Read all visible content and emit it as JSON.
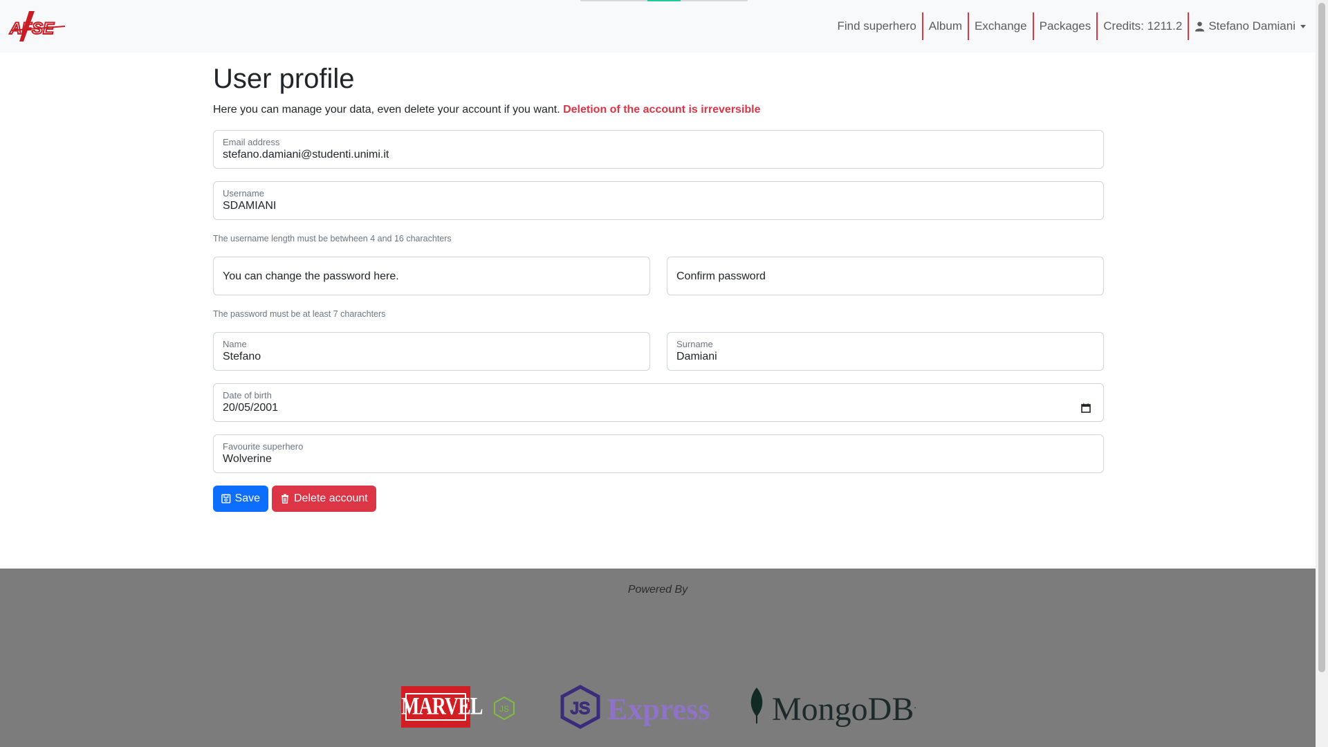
{
  "navbar": {
    "brand": "AFSE",
    "items": [
      {
        "label": "Find superhero"
      },
      {
        "label": "Album"
      },
      {
        "label": "Exchange"
      },
      {
        "label": "Packages"
      }
    ],
    "credits": "Credits: 1211.2",
    "user": "Stefano Damiani",
    "accent_color": "#dc3545"
  },
  "page": {
    "title": "User profile",
    "subtitle": "Here you can manage your data, even delete your account if you want.",
    "warning": "Deletion of the account is irreversible"
  },
  "form": {
    "email": {
      "label": "Email address",
      "value": "stefano.damiani@studenti.unimi.it"
    },
    "username": {
      "label": "Username",
      "value": "SDAMIANI",
      "help": "The username length must be betwheen 4 and 16 charachters"
    },
    "password": {
      "placeholder": "You can change the password here."
    },
    "confirm_password": {
      "placeholder": "Confirm password"
    },
    "password_help": "The password must be at least 7 charachters",
    "name": {
      "label": "Name",
      "value": "Stefano"
    },
    "surname": {
      "label": "Surname",
      "value": "Damiani"
    },
    "dob": {
      "label": "Date of birth",
      "value": "20/05/2001"
    },
    "favourite": {
      "label": "Favourite superhero",
      "value": "Wolverine"
    },
    "save_label": "Save",
    "delete_label": "Delete account",
    "save_color": "#0d6efd",
    "delete_color": "#dc3545"
  },
  "footer": {
    "powered_by": "Powered By",
    "logos": {
      "marvel": "MARVEL",
      "node": "JS",
      "express": "Express",
      "mongodb": "MongoDB"
    }
  }
}
